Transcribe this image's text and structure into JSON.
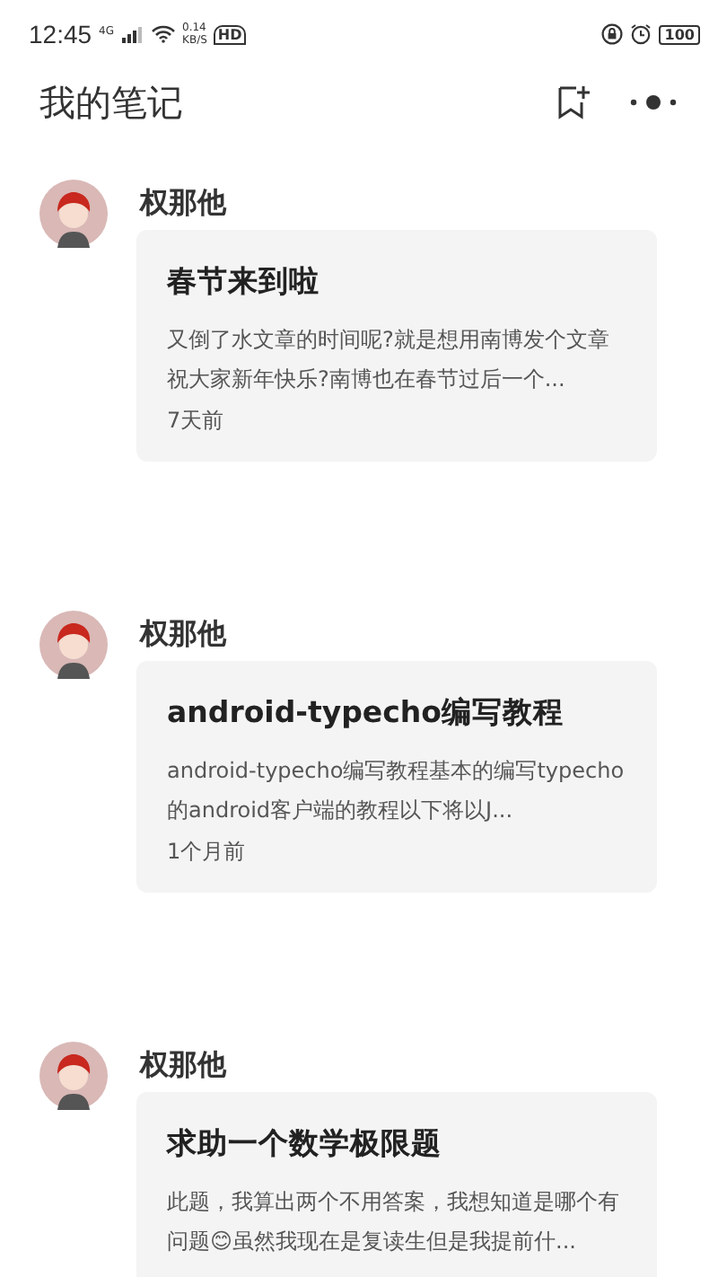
{
  "status_bar": {
    "time": "12:45",
    "network": "4G",
    "speed": "0.14",
    "speed_unit": "KB/S",
    "hd": "HD",
    "battery": "100"
  },
  "header": {
    "title": "我的笔记"
  },
  "notes": [
    {
      "author": "权那他",
      "title": "春节来到啦",
      "excerpt": "又倒了水文章的时间呢?就是想用南博发个文章祝大家新年快乐?南博也在春节过后一个...",
      "time": "7天前"
    },
    {
      "author": "权那他",
      "title": "android-typecho编写教程",
      "excerpt": "android-typecho编写教程基本的编写typecho的android客户端的教程以下将以J...",
      "time": "1个月前"
    },
    {
      "author": "权那他",
      "title": "求助一个数学极限题",
      "excerpt": "此题，我算出两个不用答案，我想知道是哪个有问题😊虽然我现在是复读生但是我提前什..."
    }
  ]
}
